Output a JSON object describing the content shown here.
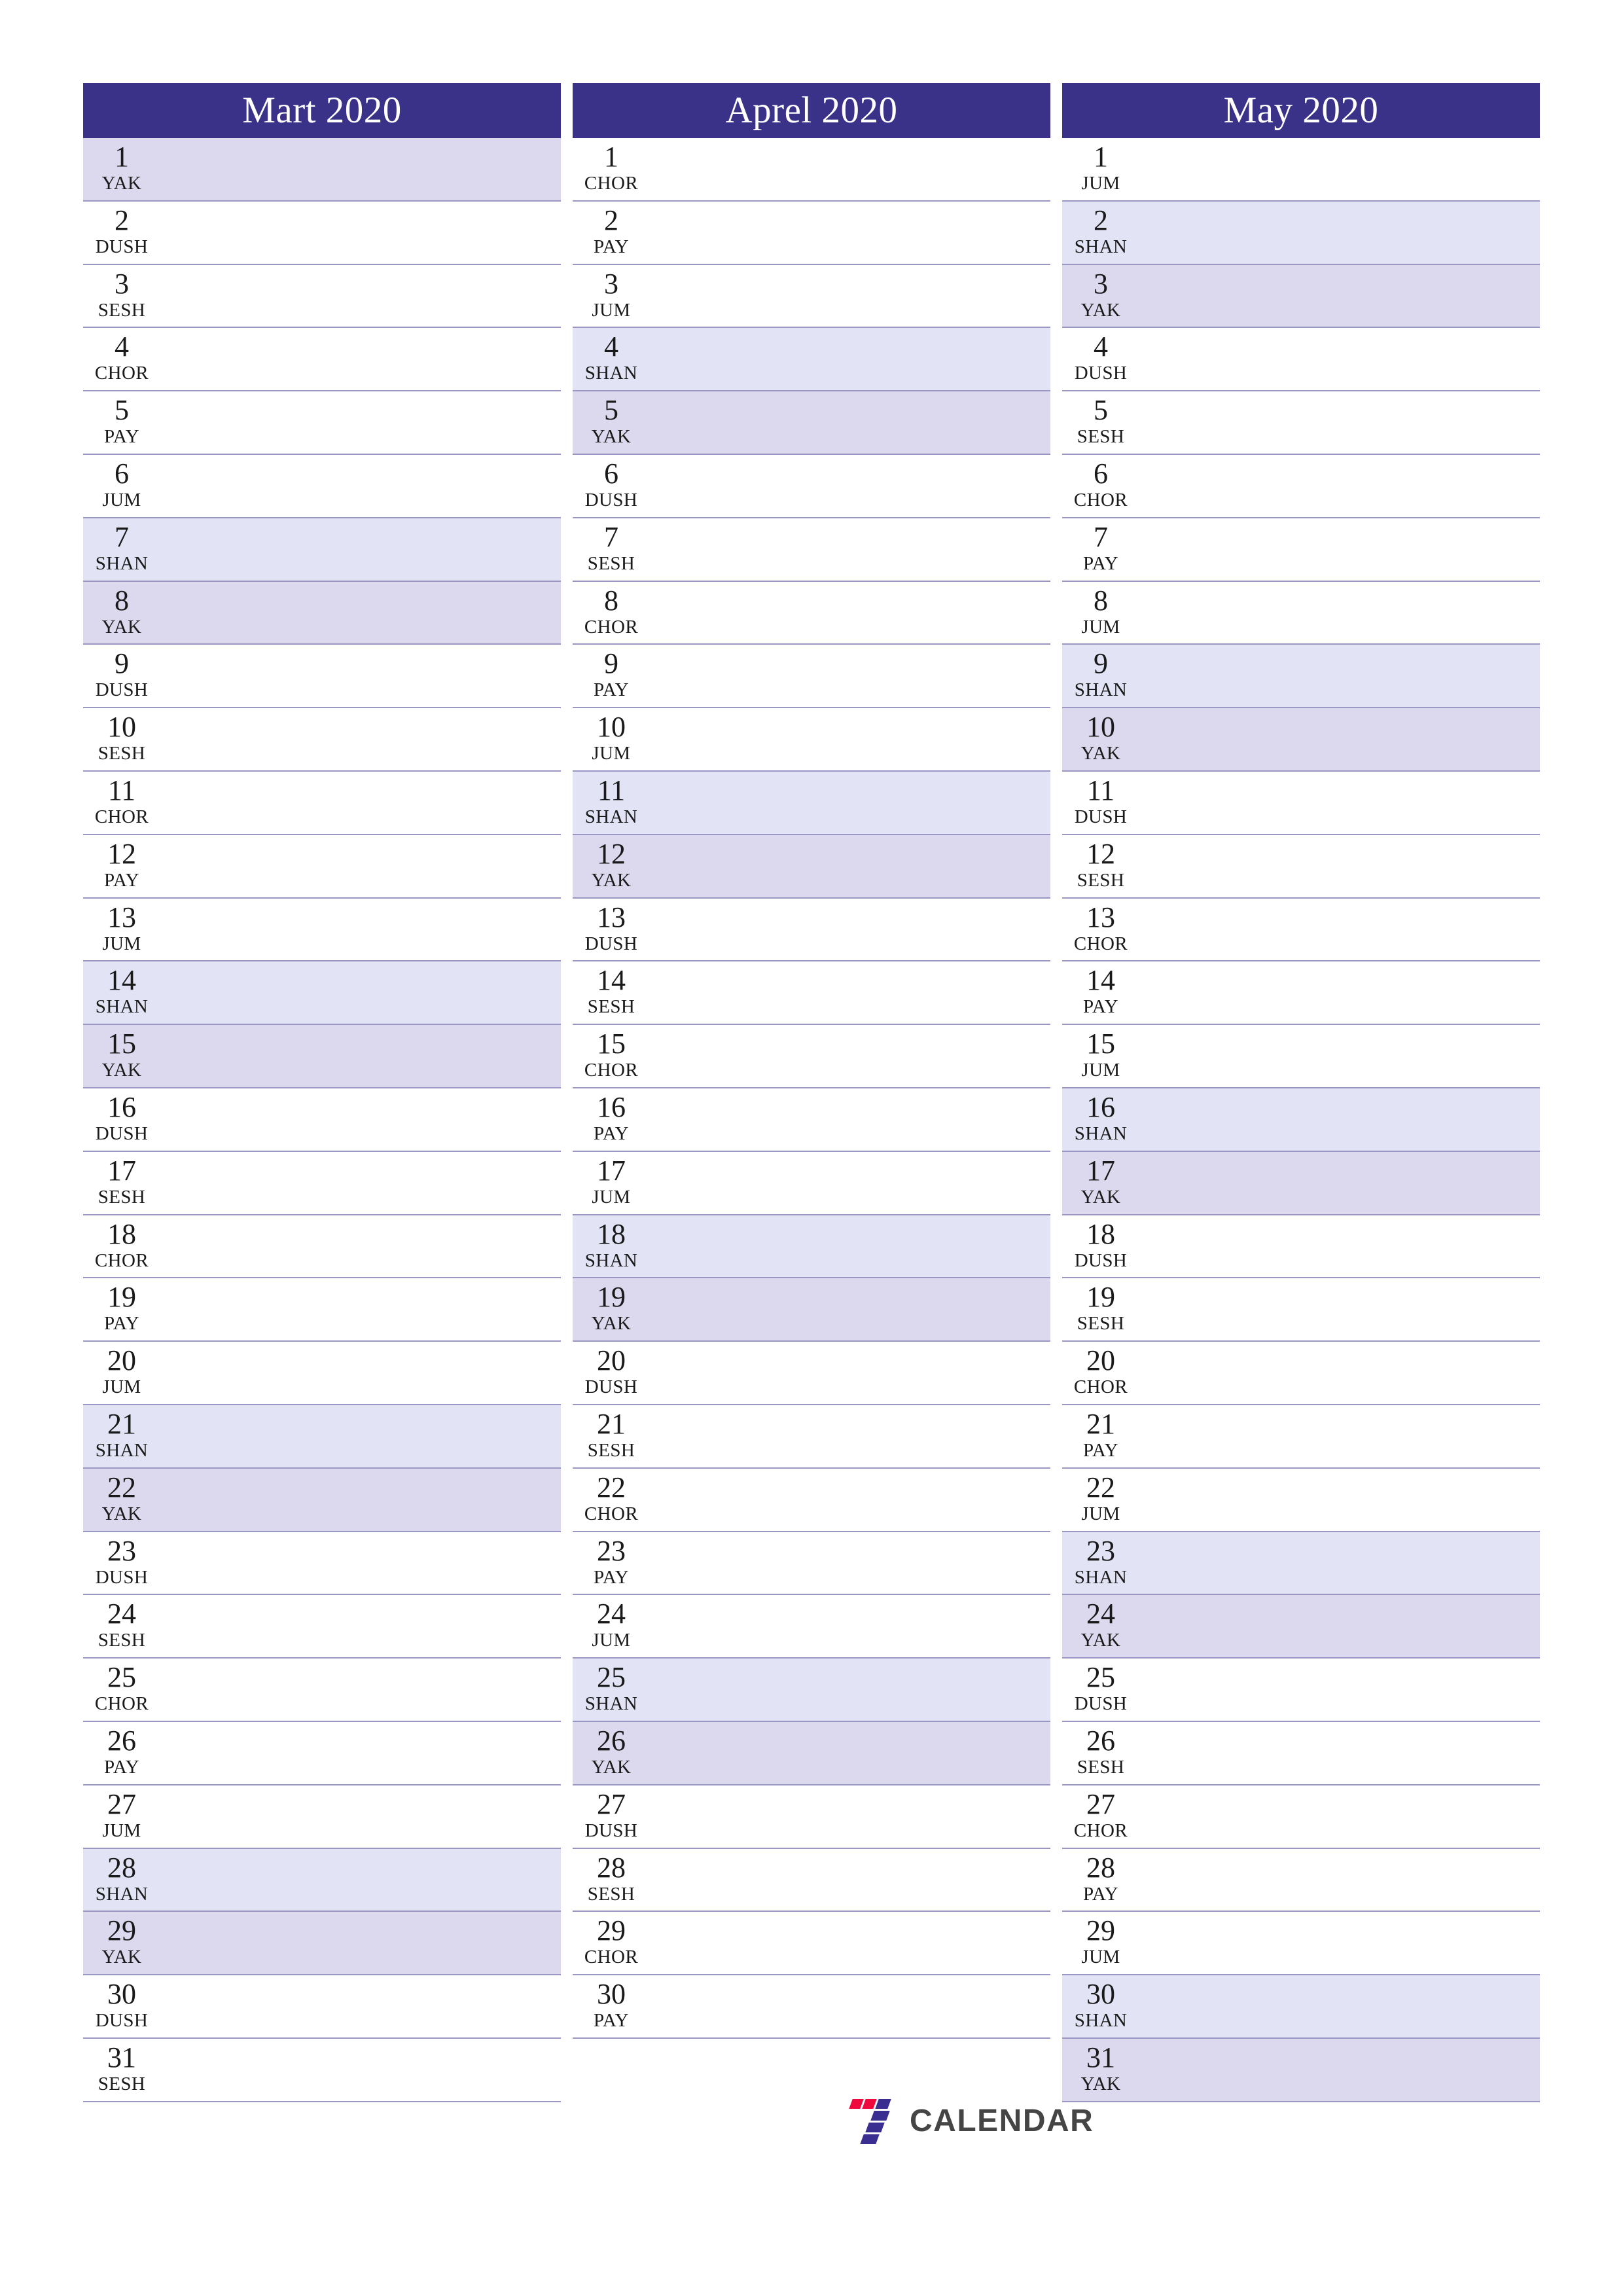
{
  "document": {
    "kind": "three-month-planner",
    "year": "2020",
    "language_hint": "uz"
  },
  "theme": {
    "header_bg": "#3a3288",
    "header_text": "#ffffff",
    "saturday_bg": "#e3e3f6",
    "sunday_bg": "#dcd8ee",
    "row_border": "#9a97c4",
    "page_bg": "#ffffff",
    "text": "#1a1a1a"
  },
  "weekday_names": {
    "sunday": "YAK",
    "monday": "DUSH",
    "tuesday": "SESH",
    "wednesday": "CHOR",
    "thursday": "PAY",
    "friday": "JUM",
    "saturday": "SHAN"
  },
  "months": [
    {
      "title": "Mart 2020",
      "name": "Mart",
      "year": "2020",
      "days": [
        {
          "num": "1",
          "wd": "YAK",
          "type": "sun"
        },
        {
          "num": "2",
          "wd": "DUSH",
          "type": "wd"
        },
        {
          "num": "3",
          "wd": "SESH",
          "type": "wd"
        },
        {
          "num": "4",
          "wd": "CHOR",
          "type": "wd"
        },
        {
          "num": "5",
          "wd": "PAY",
          "type": "wd"
        },
        {
          "num": "6",
          "wd": "JUM",
          "type": "wd"
        },
        {
          "num": "7",
          "wd": "SHAN",
          "type": "sat"
        },
        {
          "num": "8",
          "wd": "YAK",
          "type": "sun"
        },
        {
          "num": "9",
          "wd": "DUSH",
          "type": "wd"
        },
        {
          "num": "10",
          "wd": "SESH",
          "type": "wd"
        },
        {
          "num": "11",
          "wd": "CHOR",
          "type": "wd"
        },
        {
          "num": "12",
          "wd": "PAY",
          "type": "wd"
        },
        {
          "num": "13",
          "wd": "JUM",
          "type": "wd"
        },
        {
          "num": "14",
          "wd": "SHAN",
          "type": "sat"
        },
        {
          "num": "15",
          "wd": "YAK",
          "type": "sun"
        },
        {
          "num": "16",
          "wd": "DUSH",
          "type": "wd"
        },
        {
          "num": "17",
          "wd": "SESH",
          "type": "wd"
        },
        {
          "num": "18",
          "wd": "CHOR",
          "type": "wd"
        },
        {
          "num": "19",
          "wd": "PAY",
          "type": "wd"
        },
        {
          "num": "20",
          "wd": "JUM",
          "type": "wd"
        },
        {
          "num": "21",
          "wd": "SHAN",
          "type": "sat"
        },
        {
          "num": "22",
          "wd": "YAK",
          "type": "sun"
        },
        {
          "num": "23",
          "wd": "DUSH",
          "type": "wd"
        },
        {
          "num": "24",
          "wd": "SESH",
          "type": "wd"
        },
        {
          "num": "25",
          "wd": "CHOR",
          "type": "wd"
        },
        {
          "num": "26",
          "wd": "PAY",
          "type": "wd"
        },
        {
          "num": "27",
          "wd": "JUM",
          "type": "wd"
        },
        {
          "num": "28",
          "wd": "SHAN",
          "type": "sat"
        },
        {
          "num": "29",
          "wd": "YAK",
          "type": "sun"
        },
        {
          "num": "30",
          "wd": "DUSH",
          "type": "wd"
        },
        {
          "num": "31",
          "wd": "SESH",
          "type": "wd"
        }
      ]
    },
    {
      "title": "Aprel 2020",
      "name": "Aprel",
      "year": "2020",
      "days": [
        {
          "num": "1",
          "wd": "CHOR",
          "type": "wd"
        },
        {
          "num": "2",
          "wd": "PAY",
          "type": "wd"
        },
        {
          "num": "3",
          "wd": "JUM",
          "type": "wd"
        },
        {
          "num": "4",
          "wd": "SHAN",
          "type": "sat"
        },
        {
          "num": "5",
          "wd": "YAK",
          "type": "sun"
        },
        {
          "num": "6",
          "wd": "DUSH",
          "type": "wd"
        },
        {
          "num": "7",
          "wd": "SESH",
          "type": "wd"
        },
        {
          "num": "8",
          "wd": "CHOR",
          "type": "wd"
        },
        {
          "num": "9",
          "wd": "PAY",
          "type": "wd"
        },
        {
          "num": "10",
          "wd": "JUM",
          "type": "wd"
        },
        {
          "num": "11",
          "wd": "SHAN",
          "type": "sat"
        },
        {
          "num": "12",
          "wd": "YAK",
          "type": "sun"
        },
        {
          "num": "13",
          "wd": "DUSH",
          "type": "wd"
        },
        {
          "num": "14",
          "wd": "SESH",
          "type": "wd"
        },
        {
          "num": "15",
          "wd": "CHOR",
          "type": "wd"
        },
        {
          "num": "16",
          "wd": "PAY",
          "type": "wd"
        },
        {
          "num": "17",
          "wd": "JUM",
          "type": "wd"
        },
        {
          "num": "18",
          "wd": "SHAN",
          "type": "sat"
        },
        {
          "num": "19",
          "wd": "YAK",
          "type": "sun"
        },
        {
          "num": "20",
          "wd": "DUSH",
          "type": "wd"
        },
        {
          "num": "21",
          "wd": "SESH",
          "type": "wd"
        },
        {
          "num": "22",
          "wd": "CHOR",
          "type": "wd"
        },
        {
          "num": "23",
          "wd": "PAY",
          "type": "wd"
        },
        {
          "num": "24",
          "wd": "JUM",
          "type": "wd"
        },
        {
          "num": "25",
          "wd": "SHAN",
          "type": "sat"
        },
        {
          "num": "26",
          "wd": "YAK",
          "type": "sun"
        },
        {
          "num": "27",
          "wd": "DUSH",
          "type": "wd"
        },
        {
          "num": "28",
          "wd": "SESH",
          "type": "wd"
        },
        {
          "num": "29",
          "wd": "CHOR",
          "type": "wd"
        },
        {
          "num": "30",
          "wd": "PAY",
          "type": "wd"
        }
      ]
    },
    {
      "title": "May 2020",
      "name": "May",
      "year": "2020",
      "days": [
        {
          "num": "1",
          "wd": "JUM",
          "type": "wd"
        },
        {
          "num": "2",
          "wd": "SHAN",
          "type": "sat"
        },
        {
          "num": "3",
          "wd": "YAK",
          "type": "sun"
        },
        {
          "num": "4",
          "wd": "DUSH",
          "type": "wd"
        },
        {
          "num": "5",
          "wd": "SESH",
          "type": "wd"
        },
        {
          "num": "6",
          "wd": "CHOR",
          "type": "wd"
        },
        {
          "num": "7",
          "wd": "PAY",
          "type": "wd"
        },
        {
          "num": "8",
          "wd": "JUM",
          "type": "wd"
        },
        {
          "num": "9",
          "wd": "SHAN",
          "type": "sat"
        },
        {
          "num": "10",
          "wd": "YAK",
          "type": "sun"
        },
        {
          "num": "11",
          "wd": "DUSH",
          "type": "wd"
        },
        {
          "num": "12",
          "wd": "SESH",
          "type": "wd"
        },
        {
          "num": "13",
          "wd": "CHOR",
          "type": "wd"
        },
        {
          "num": "14",
          "wd": "PAY",
          "type": "wd"
        },
        {
          "num": "15",
          "wd": "JUM",
          "type": "wd"
        },
        {
          "num": "16",
          "wd": "SHAN",
          "type": "sat"
        },
        {
          "num": "17",
          "wd": "YAK",
          "type": "sun"
        },
        {
          "num": "18",
          "wd": "DUSH",
          "type": "wd"
        },
        {
          "num": "19",
          "wd": "SESH",
          "type": "wd"
        },
        {
          "num": "20",
          "wd": "CHOR",
          "type": "wd"
        },
        {
          "num": "21",
          "wd": "PAY",
          "type": "wd"
        },
        {
          "num": "22",
          "wd": "JUM",
          "type": "wd"
        },
        {
          "num": "23",
          "wd": "SHAN",
          "type": "sat"
        },
        {
          "num": "24",
          "wd": "YAK",
          "type": "sun"
        },
        {
          "num": "25",
          "wd": "DUSH",
          "type": "wd"
        },
        {
          "num": "26",
          "wd": "SESH",
          "type": "wd"
        },
        {
          "num": "27",
          "wd": "CHOR",
          "type": "wd"
        },
        {
          "num": "28",
          "wd": "PAY",
          "type": "wd"
        },
        {
          "num": "29",
          "wd": "JUM",
          "type": "wd"
        },
        {
          "num": "30",
          "wd": "SHAN",
          "type": "sat"
        },
        {
          "num": "31",
          "wd": "YAK",
          "type": "sun"
        }
      ]
    }
  ],
  "brand": {
    "text": "CALENDAR",
    "mark": "seven-logo-mark",
    "mark_colors": [
      "#ee0a3c",
      "#3b2e91"
    ]
  }
}
